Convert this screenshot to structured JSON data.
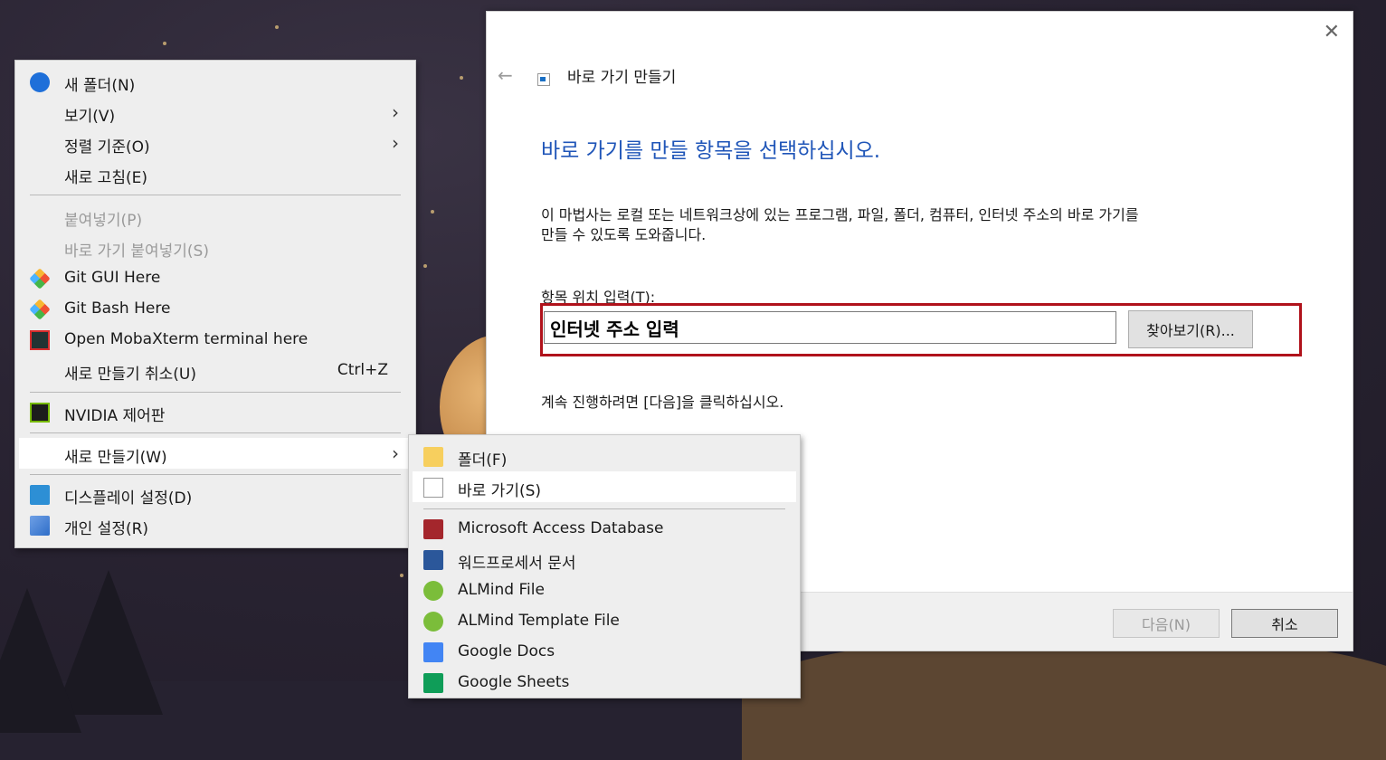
{
  "context_menu": {
    "items": [
      {
        "label": "새 폴더(N)",
        "icon": "new-folder-icon"
      },
      {
        "label": "보기(V)",
        "submenu": true
      },
      {
        "label": "정렬 기준(O)",
        "submenu": true
      },
      {
        "label": "새로 고침(E)"
      },
      {
        "label": "붙여넣기(P)",
        "disabled": true
      },
      {
        "label": "바로 가기 붙여넣기(S)",
        "disabled": true
      },
      {
        "label": "Git GUI Here",
        "icon": "git-icon"
      },
      {
        "label": "Git Bash Here",
        "icon": "git-icon"
      },
      {
        "label": "Open MobaXterm terminal here",
        "icon": "mobaxterm-icon"
      },
      {
        "label": "새로 만들기 취소(U)",
        "shortcut": "Ctrl+Z"
      },
      {
        "label": "NVIDIA 제어판",
        "icon": "nvidia-icon"
      },
      {
        "label": "새로 만들기(W)",
        "submenu": true,
        "highlighted": true
      },
      {
        "label": "디스플레이 설정(D)",
        "icon": "display-icon"
      },
      {
        "label": "개인 설정(R)",
        "icon": "personalize-icon"
      }
    ]
  },
  "new_submenu": {
    "items": [
      {
        "label": "폴더(F)",
        "icon": "folder-icon"
      },
      {
        "label": "바로 가기(S)",
        "icon": "shortcut-icon",
        "highlighted": true
      },
      {
        "label": "Microsoft Access Database",
        "icon": "access-icon"
      },
      {
        "label": "워드프로세서 문서",
        "icon": "word-icon"
      },
      {
        "label": "ALMind File",
        "icon": "almind-icon"
      },
      {
        "label": "ALMind Template File",
        "icon": "almind-icon"
      },
      {
        "label": "Google Docs",
        "icon": "google-docs-icon"
      },
      {
        "label": "Google Sheets",
        "icon": "google-sheets-icon"
      }
    ]
  },
  "dialog": {
    "title": "바로 가기 만들기",
    "heading": "바로 가기를 만들 항목을 선택하십시오.",
    "description_line1": "이 마법사는 로컬 또는 네트워크상에 있는 프로그램, 파일, 폴더, 컴퓨터, 인터넷 주소의 바로 가기를",
    "description_line2": "만들 수 있도록 도와줍니다.",
    "field_label": "항목 위치 입력(T):",
    "location_value": "인터넷 주소 입력",
    "browse_label": "찾아보기(R)...",
    "instruction": "계속 진행하려면 [다음]을 클릭하십시오.",
    "next_label": "다음(N)",
    "cancel_label": "취소",
    "close_glyph": "✕",
    "back_glyph": "←"
  },
  "colors": {
    "heading_blue": "#1f55b8",
    "highlight_red": "#b0121b",
    "menu_bg": "#eeeeee"
  }
}
